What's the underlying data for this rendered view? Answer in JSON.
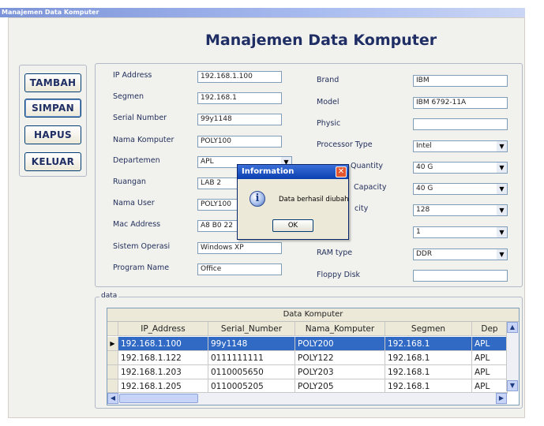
{
  "window": {
    "title": "Manajemen Data Komputer"
  },
  "heading": "Manajemen Data Komputer",
  "buttons": {
    "tambah": "TAMBAH",
    "simpan": "SIMPAN",
    "hapus": "HAPUS",
    "keluar": "KELUAR"
  },
  "form": {
    "ip_address": {
      "label": "IP Address",
      "value": "192.168.1.100"
    },
    "segmen": {
      "label": "Segmen",
      "value": "192.168.1"
    },
    "serial_number": {
      "label": "Serial Number",
      "value": "99y1148"
    },
    "nama_komputer": {
      "label": "Nama Komputer",
      "value": "POLY100"
    },
    "departemen": {
      "label": "Departemen",
      "value": "APL"
    },
    "ruangan": {
      "label": "Ruangan",
      "value": "LAB 2"
    },
    "nama_user": {
      "label": "Nama User",
      "value": "POLY100"
    },
    "mac_address": {
      "label": "Mac Address",
      "value": "A8 B0 22"
    },
    "sistem_operasi": {
      "label": "Sistem Operasi",
      "value": "Windows XP"
    },
    "program_name": {
      "label": "Program Name",
      "value": "Office"
    },
    "brand": {
      "label": "Brand",
      "value": "IBM"
    },
    "model": {
      "label": "Model",
      "value": "IBM 6792-11A"
    },
    "physic": {
      "label": "Physic",
      "value": ""
    },
    "processor_type": {
      "label": "Processor Type",
      "value": "Intel"
    },
    "hd_quantity": {
      "label": "Quantity",
      "value": "40 G"
    },
    "hd_capacity": {
      "label": "Capacity",
      "value": "40 G"
    },
    "memory_capacity": {
      "label": "city",
      "value": "128"
    },
    "ninth": {
      "value": "1"
    },
    "ram_type": {
      "label": "RAM type",
      "value": "DDR"
    },
    "floppy_disk": {
      "label": "Floppy Disk",
      "value": ""
    }
  },
  "data_group": {
    "label": "data",
    "grid_title": "Data Komputer",
    "columns": [
      "IP_Address",
      "Serial_Number",
      "Nama_Komputer",
      "Segmen",
      "Dep"
    ],
    "rows": [
      [
        "192.168.1.100",
        "99y1148",
        "POLY200",
        "192.168.1",
        "APL"
      ],
      [
        "192.168.1.122",
        "0111111111",
        "POLY122",
        "192.168.1",
        "APL"
      ],
      [
        "192.168.1.203",
        "0110005650",
        "POLY203",
        "192.168.1",
        "APL"
      ],
      [
        "192.168.1.205",
        "0110005205",
        "POLY205",
        "192.168.1",
        "APL"
      ]
    ]
  },
  "dialog": {
    "title": "Information",
    "message": "Data berhasil diubah",
    "ok_label": "OK",
    "icon": "info-icon"
  },
  "colors": {
    "title_bar": "#7b93d8",
    "heading": "#1f2e64",
    "selection": "#316ac5",
    "dialog_title": "#0a3fb0"
  }
}
